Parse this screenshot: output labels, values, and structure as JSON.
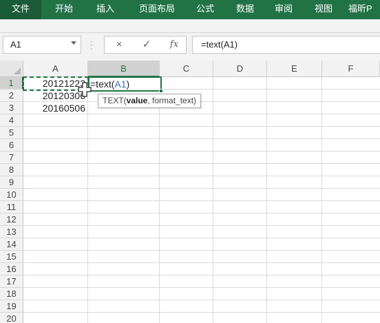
{
  "ribbon": {
    "tabs": [
      {
        "label": "文件",
        "active": true
      },
      {
        "label": "开始"
      },
      {
        "label": "插入"
      },
      {
        "label": "页面布局"
      },
      {
        "label": "公式"
      },
      {
        "label": "数据"
      },
      {
        "label": "审阅"
      },
      {
        "label": "视图"
      },
      {
        "label": "福昕P"
      }
    ]
  },
  "formula_bar": {
    "name_box": "A1",
    "cancel_icon": "×",
    "enter_icon": "✓",
    "fx_label": "fx",
    "formula": "=text(A1)"
  },
  "sheet": {
    "columns": [
      "A",
      "B",
      "C",
      "D",
      "E",
      "F"
    ],
    "rows": [
      "1",
      "2",
      "3",
      "4",
      "5",
      "6",
      "7",
      "8",
      "9",
      "10",
      "11",
      "12",
      "13",
      "14",
      "15",
      "16",
      "17",
      "18",
      "19",
      "20"
    ],
    "cells": {
      "A1": "20121223",
      "A2": "20120306",
      "A3": "20160506"
    },
    "active_cell": {
      "prefix": "=text(",
      "ref": "A1",
      "suffix": ")"
    },
    "tooltip": {
      "fn": "TEXT(",
      "arg1": "value",
      "rest": ", format_text)"
    }
  },
  "colors": {
    "accent": "#217346",
    "ref": "#2f6fb5"
  }
}
